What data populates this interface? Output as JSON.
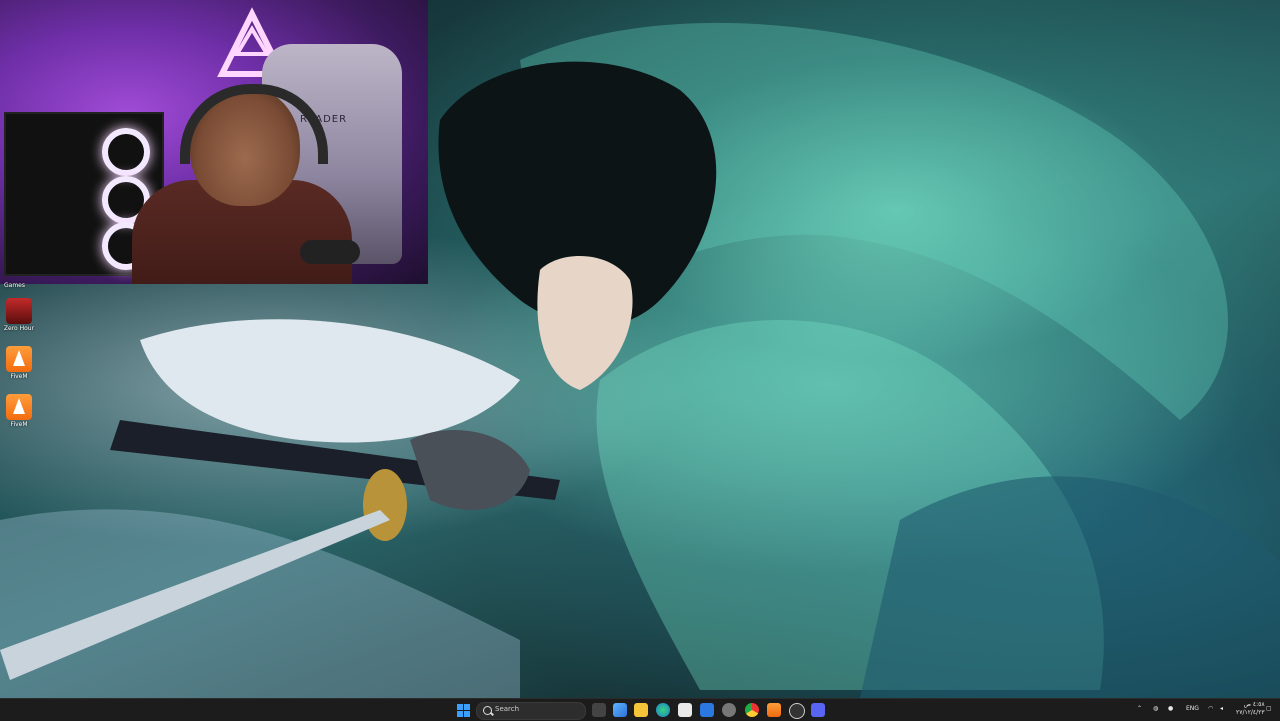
{
  "desktop": {
    "games_label": "Games",
    "icons": [
      {
        "label": "Zero Hour",
        "icon": "zero-hour-icon"
      },
      {
        "label": "FiveM",
        "icon": "fivem-icon"
      },
      {
        "label": "FiveM",
        "icon": "fivem-icon"
      }
    ]
  },
  "webcam": {
    "chair_brand": "READER"
  },
  "taskbar": {
    "search_placeholder": "Search",
    "language": "ENG",
    "clock_time": "٤:٥٨ ص",
    "clock_date": "٢٧/١٢/٤/٢٣",
    "accent_color": "#3aa0ff",
    "pinned": [
      "task-view-icon",
      "widgets-icon",
      "file-explorer-icon",
      "edge-icon",
      "store-icon",
      "mail-icon",
      "settings-icon",
      "chrome-icon",
      "fivem-icon",
      "obs-icon",
      "discord-icon"
    ]
  }
}
